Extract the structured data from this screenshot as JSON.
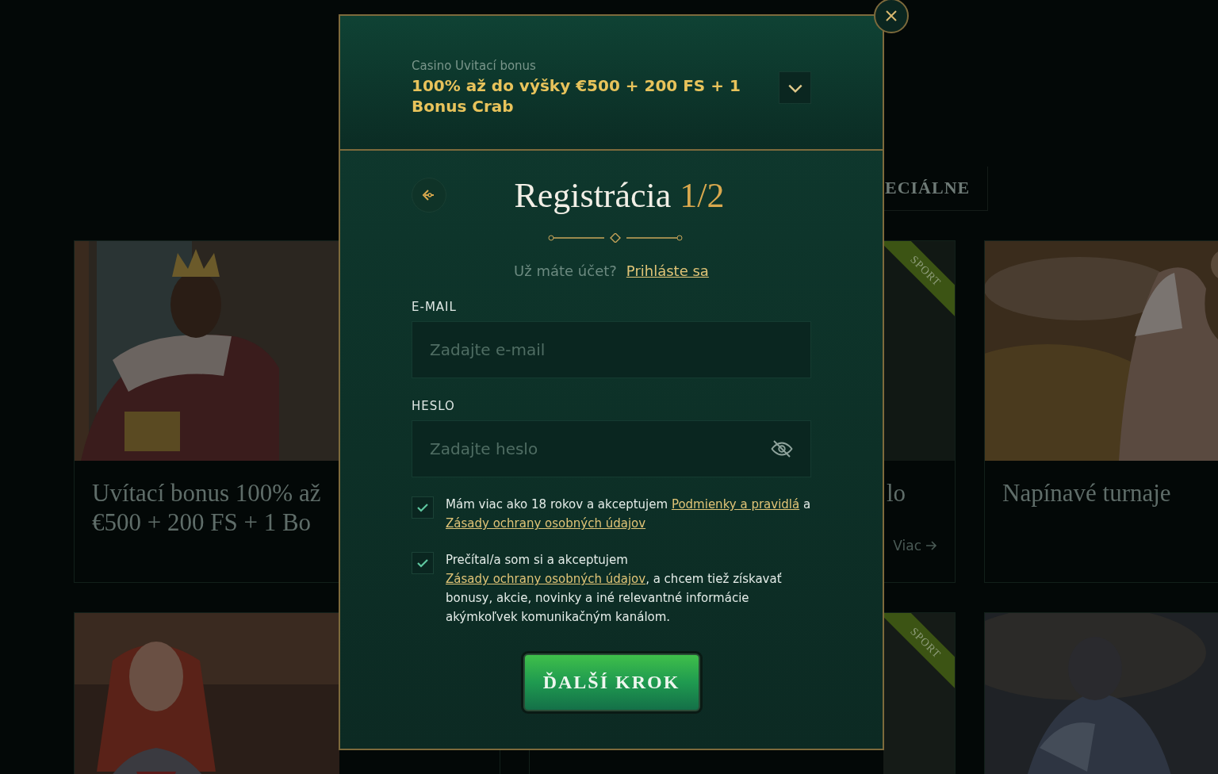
{
  "background": {
    "tabs": [
      {
        "label": "ECIÁLNE"
      }
    ],
    "cards": [
      {
        "kind": "picture",
        "title_lines": [
          "Uvítací bonus 100% až",
          "€500 + 200 FS + 1 Bo"
        ]
      },
      {
        "kind": "picture",
        "ribbon": "SPORT",
        "title_lines": [
          "lo"
        ],
        "link": "Viac"
      },
      {
        "kind": "picture",
        "title_lines": [
          "Napínavé turnaje"
        ]
      },
      {
        "kind": "picture"
      },
      {
        "kind": "picture",
        "ribbon": "SPORT"
      },
      {
        "kind": "picture"
      }
    ]
  },
  "modal": {
    "bonus": {
      "caption": "Casino Uvitací bonus",
      "title": "100% až do výšky €500 + 200 FS + 1 Bonus Crab",
      "expanded": false
    },
    "heading": "Registrácia",
    "step": "1/2",
    "login_prompt": "Už máte účet?",
    "login_link": "Prihláste sa",
    "fields": [
      {
        "kind": "email",
        "label": "E-MAIL",
        "placeholder": "Zadajte e-mail"
      },
      {
        "kind": "password",
        "label": "HESLO",
        "placeholder": "Zadajte heslo"
      }
    ],
    "consents": [
      {
        "checked": true,
        "parts": [
          {
            "text": "Mám viac ako 18 rokov a akceptujem "
          },
          {
            "link": "Podmienky a pravidlá"
          },
          {
            "text": " a "
          },
          {
            "link": "Zásady ochrany osobných údajov"
          }
        ]
      },
      {
        "checked": true,
        "parts": [
          {
            "text": "Prečítal/a som si a akceptujem "
          },
          {
            "link": "Zásady ochrany osobných údajov"
          },
          {
            "text": ", a chcem tiež získavať bonusy, akcie, novinky a iné relevantné informácie akýmkoľvek komunikačným kanálom."
          }
        ]
      }
    ],
    "submit": "ĎALŠÍ KROK"
  }
}
